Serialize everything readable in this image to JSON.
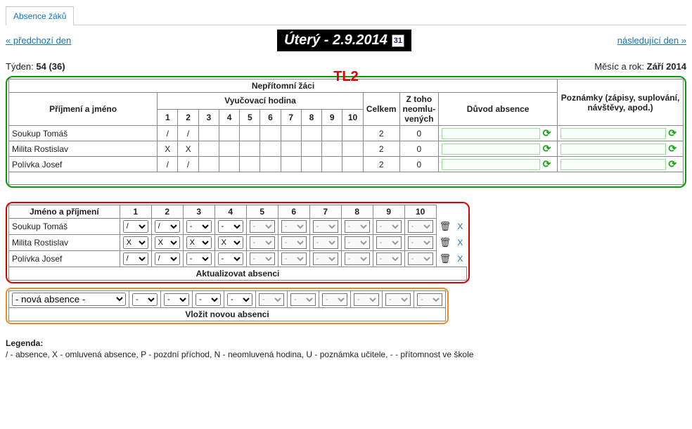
{
  "tab_title": "Absence žáků",
  "nav": {
    "prev": "« předchozí den",
    "next": "následující den »"
  },
  "date_banner": "Úterý - 2.9.2014",
  "annotation": "TL2",
  "week": {
    "label": "Týden:",
    "value": "54 (36)"
  },
  "month": {
    "label": "Měsíc a rok:",
    "value": "Září 2014"
  },
  "green_table": {
    "header_main": "Nepřítomní žáci",
    "h_name": "Příjmení a jméno",
    "h_lesson": "Vyučovací hodina",
    "h_total": "Celkem",
    "h_unex": "Z toho neomlu-vených",
    "h_reason": "Důvod absence",
    "h_notes": "Poznámky (zápisy, suplování, návštěvy, apod.)",
    "periods": [
      "1",
      "2",
      "3",
      "4",
      "5",
      "6",
      "7",
      "8",
      "9",
      "10"
    ],
    "rows": [
      {
        "name": "Soukup Tomáš",
        "periods": [
          "/",
          "/",
          "",
          "",
          "",
          "",
          "",
          "",
          "",
          ""
        ],
        "total": "2",
        "unex": "0"
      },
      {
        "name": "Milita Rostislav",
        "periods": [
          "X",
          "X",
          "",
          "",
          "",
          "",
          "",
          "",
          "",
          ""
        ],
        "total": "2",
        "unex": "0"
      },
      {
        "name": "Polívka Josef",
        "periods": [
          "/",
          "/",
          "",
          "",
          "",
          "",
          "",
          "",
          "",
          ""
        ],
        "total": "2",
        "unex": "0"
      }
    ]
  },
  "red_table": {
    "h_name": "Jméno a příjmení",
    "periods": [
      "1",
      "2",
      "3",
      "4",
      "5",
      "6",
      "7",
      "8",
      "9",
      "10"
    ],
    "rows": [
      {
        "name": "Soukup Tomáš",
        "vals": [
          "/",
          "/",
          "-",
          "-",
          "-",
          "-",
          "-",
          "-",
          "-",
          "-"
        ],
        "active": 4
      },
      {
        "name": "Milita Rostislav",
        "vals": [
          "X",
          "X",
          "X",
          "X",
          "-",
          "-",
          "-",
          "-",
          "-",
          "-"
        ],
        "active": 4
      },
      {
        "name": "Polívka Josef",
        "vals": [
          "/",
          "/",
          "-",
          "-",
          "-",
          "-",
          "-",
          "-",
          "-",
          "-"
        ],
        "active": 4
      }
    ],
    "button": "Aktualizovat absenci"
  },
  "orange_table": {
    "name_options": [
      "- nová absence -"
    ],
    "vals": [
      "-",
      "-",
      "-",
      "-",
      "-",
      "-",
      "-",
      "-",
      "-",
      "-"
    ],
    "active": 4,
    "button": "Vložit novou absenci"
  },
  "legend": {
    "title": "Legenda:",
    "text": "/ - absence, X - omluvená absence, P - pozdní příchod, N - neomluvená hodina, U - poznámka učitele, - - přítomnost ve škole"
  },
  "icons": {
    "calendar": "31",
    "trash": "🗑",
    "refresh": "⟳",
    "x": "X"
  }
}
